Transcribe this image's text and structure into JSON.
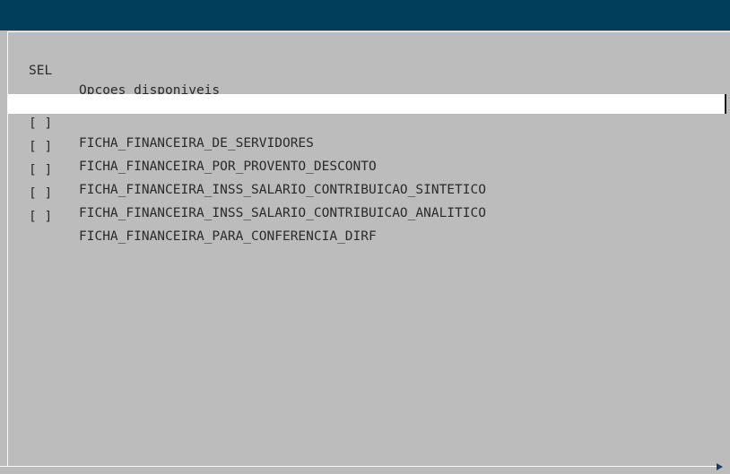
{
  "header": {
    "sel_label": "SEL",
    "options_label": "Opcoes disponiveis"
  },
  "separator": {
    "sel": "----",
    "options": "----------------------------------------------------------------------------------------------------------"
  },
  "items": [
    {
      "checkbox": "[ ]",
      "label": "FICHA_FINANCEIRA_DE_SERVIDORES",
      "selected": true
    },
    {
      "checkbox": "[ ]",
      "label": "FICHA_FINANCEIRA_POR_PROVENTO_DESCONTO",
      "selected": false
    },
    {
      "checkbox": "[ ]",
      "label": "FICHA_FINANCEIRA_INSS_SALARIO_CONTRIBUICAO_SINTETICO",
      "selected": false
    },
    {
      "checkbox": "[ ]",
      "label": "FICHA_FINANCEIRA_INSS_SALARIO_CONTRIBUICAO_ANALITICO",
      "selected": false
    },
    {
      "checkbox": "[ ]",
      "label": "FICHA_FINANCEIRA_PARA_CONFERENCIA_DIRF",
      "selected": false
    }
  ],
  "colors": {
    "titlebar": "#003e5c",
    "background": "#bcbcbc",
    "highlight": "#ffffff"
  },
  "icons": {
    "scroll_right": "triangle-right-icon"
  }
}
